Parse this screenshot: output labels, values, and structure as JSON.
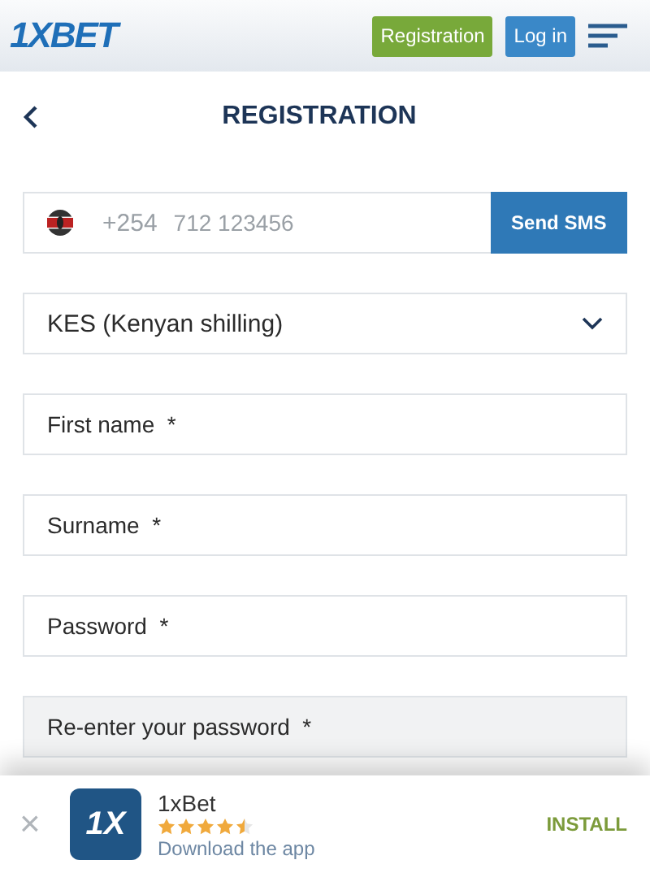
{
  "header": {
    "logo": "1XBET",
    "buttons": [
      {
        "label": "Registration",
        "kind": "register"
      },
      {
        "label": "Log in",
        "kind": "login"
      }
    ]
  },
  "page_title": "REGISTRATION",
  "phone": {
    "prefix": "+254",
    "placeholder": "712 123456",
    "button": "Send SMS"
  },
  "currency": {
    "value": "KES (Kenyan shilling)"
  },
  "fields": [
    {
      "placeholder": "First name  *"
    },
    {
      "placeholder": "Surname  *"
    },
    {
      "placeholder": "Password  *"
    },
    {
      "placeholder": "Re-enter your password  *"
    }
  ],
  "app_banner": {
    "close": "×",
    "logo": "1X",
    "name": "1xBet",
    "stars": 4.5,
    "subtitle": "Download the app",
    "action": "INSTALL"
  }
}
